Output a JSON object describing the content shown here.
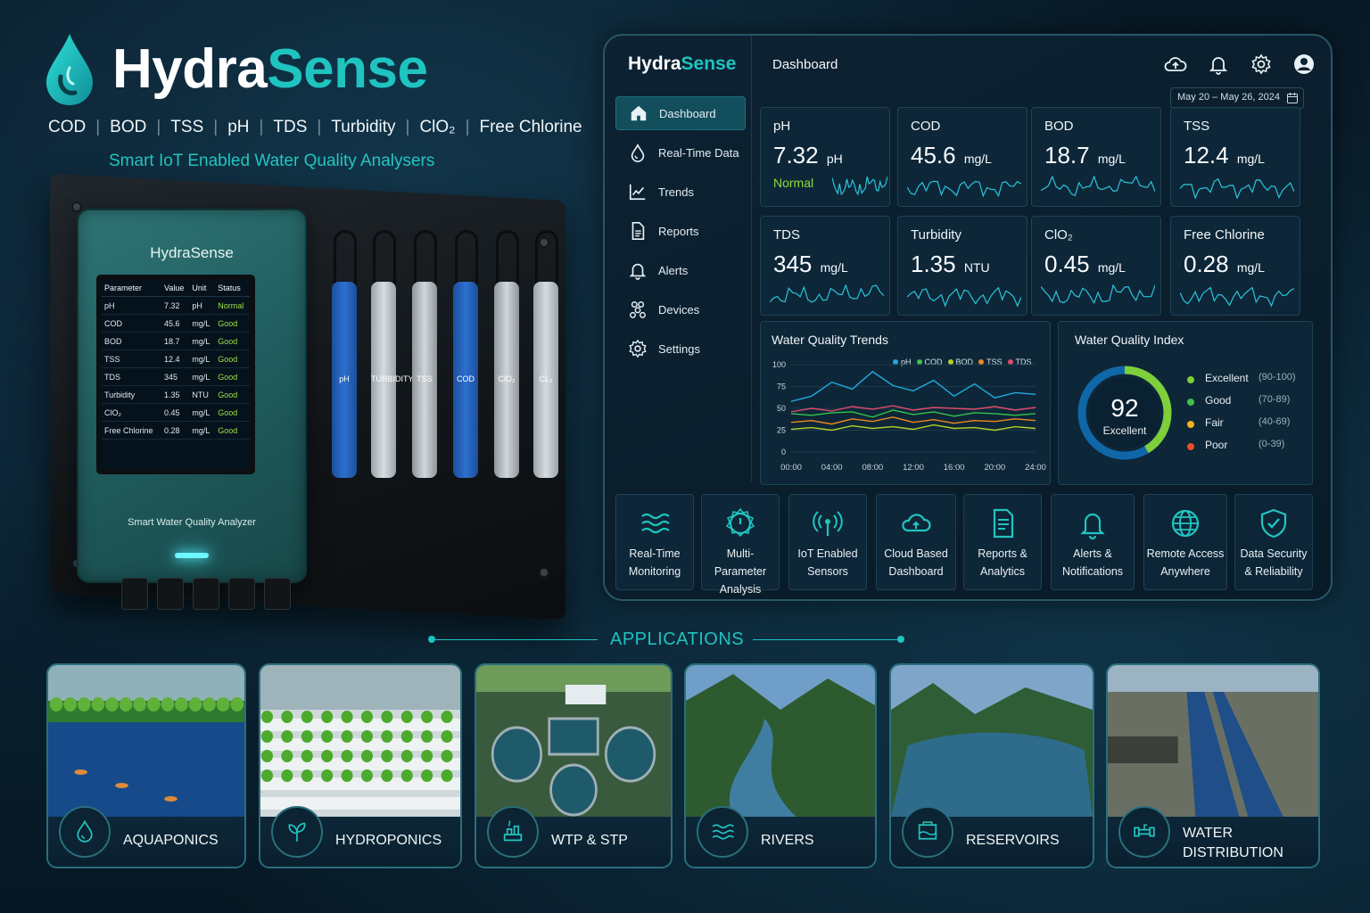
{
  "brand": {
    "name_part1": "Hydra",
    "name_part2": "Sense",
    "parameters": [
      "COD",
      "BOD",
      "TSS",
      "pH",
      "TDS",
      "Turbidity",
      "ClO₂",
      "Free Chlorine"
    ],
    "tagline": "Smart IoT Enabled Water Quality Analysers",
    "accent_color": "#1fc3c0"
  },
  "device": {
    "brand": "HydraSense",
    "caption": "Smart Water Quality Analyzer",
    "table_headers": [
      "Parameter",
      "Value",
      "Unit",
      "Status"
    ],
    "rows": [
      [
        "pH",
        "7.32",
        "pH",
        "Normal"
      ],
      [
        "COD",
        "45.6",
        "mg/L",
        "Good"
      ],
      [
        "BOD",
        "18.7",
        "mg/L",
        "Good"
      ],
      [
        "TSS",
        "12.4",
        "mg/L",
        "Good"
      ],
      [
        "TDS",
        "345",
        "mg/L",
        "Good"
      ],
      [
        "Turbidity",
        "1.35",
        "NTU",
        "Good"
      ],
      [
        "ClO₂",
        "0.45",
        "mg/L",
        "Good"
      ],
      [
        "Free Chlorine",
        "0.28",
        "mg/L",
        "Good"
      ]
    ],
    "probes": [
      "pH",
      "TURBIDITY",
      "TSS",
      "COD",
      "ClO₂",
      "CL₂"
    ]
  },
  "dashboard": {
    "logo_part1": "Hydra",
    "logo_part2": "Sense",
    "title": "Dashboard",
    "date_range": "May 20 – May 26, 2024",
    "top_icons": [
      "cloud-upload-icon",
      "bell-icon",
      "gear-icon",
      "user-avatar-icon"
    ],
    "nav": [
      {
        "label": "Dashboard",
        "icon": "home-icon",
        "active": true
      },
      {
        "label": "Real-Time Data",
        "icon": "water-drop-icon"
      },
      {
        "label": "Trends",
        "icon": "line-chart-icon"
      },
      {
        "label": "Reports",
        "icon": "document-icon"
      },
      {
        "label": "Alerts",
        "icon": "bell-icon"
      },
      {
        "label": "Devices",
        "icon": "devices-icon"
      },
      {
        "label": "Settings",
        "icon": "gear-icon"
      }
    ],
    "metrics": [
      {
        "name": "pH",
        "value": "7.32",
        "unit": "pH",
        "status": "Normal"
      },
      {
        "name": "COD",
        "value": "45.6",
        "unit": "mg/L"
      },
      {
        "name": "BOD",
        "value": "18.7",
        "unit": "mg/L"
      },
      {
        "name": "TSS",
        "value": "12.4",
        "unit": "mg/L"
      },
      {
        "name": "TDS",
        "value": "345",
        "unit": "mg/L"
      },
      {
        "name": "Turbidity",
        "value": "1.35",
        "unit": "NTU"
      },
      {
        "name": "ClO₂",
        "value": "0.45",
        "unit": "mg/L"
      },
      {
        "name": "Free Chlorine",
        "value": "0.28",
        "unit": "mg/L"
      }
    ],
    "trends": {
      "title": "Water Quality Trends",
      "y_ticks": [
        "100",
        "75",
        "50",
        "25",
        "0"
      ],
      "x_ticks": [
        "00:00",
        "04:00",
        "08:00",
        "12:00",
        "16:00",
        "20:00",
        "24:00"
      ],
      "series_colors": {
        "pH": "#23a9e0",
        "COD": "#39c24a",
        "BOD": "#b4cf2a",
        "TSS": "#f08a1d",
        "TDS": "#e04a6a"
      }
    },
    "wqi": {
      "title": "Water Quality Index",
      "score": "92",
      "rating": "Excellent",
      "legend": [
        {
          "label": "Excellent",
          "range": "(90-100)",
          "color": "#7fcf3a"
        },
        {
          "label": "Good",
          "range": "(70-89)",
          "color": "#3fbf4a"
        },
        {
          "label": "Fair",
          "range": "(40-69)",
          "color": "#f1b21f"
        },
        {
          "label": "Poor",
          "range": "(0-39)",
          "color": "#e8502d"
        }
      ]
    },
    "features": [
      {
        "line1": "Real-Time",
        "line2": "Monitoring",
        "icon": "waves-icon"
      },
      {
        "line1": "Multi-Parameter",
        "line2": "Analysis",
        "icon": "gauge-icon"
      },
      {
        "line1": "IoT Enabled",
        "line2": "Sensors",
        "icon": "wireless-sensor-icon"
      },
      {
        "line1": "Cloud Based",
        "line2": "Dashboard",
        "icon": "cloud-icon"
      },
      {
        "line1": "Reports &",
        "line2": "Analytics",
        "icon": "report-icon"
      },
      {
        "line1": "Alerts &",
        "line2": "Notifications",
        "icon": "bell-icon"
      },
      {
        "line1": "Remote Access",
        "line2": "Anywhere",
        "icon": "globe-icon"
      },
      {
        "line1": "Data Security",
        "line2": "& Reliability",
        "icon": "shield-check-icon"
      }
    ]
  },
  "chart_data": {
    "type": "line",
    "title": "Water Quality Trends",
    "x": [
      "00:00",
      "02:00",
      "04:00",
      "06:00",
      "08:00",
      "10:00",
      "12:00",
      "14:00",
      "16:00",
      "18:00",
      "20:00",
      "22:00",
      "24:00"
    ],
    "ylim": [
      0,
      100
    ],
    "legend_position": "top-right",
    "series": [
      {
        "name": "pH",
        "values": [
          58,
          64,
          80,
          72,
          92,
          76,
          70,
          82,
          64,
          78,
          62,
          68,
          66
        ]
      },
      {
        "name": "COD",
        "values": [
          44,
          42,
          45,
          46,
          40,
          48,
          43,
          46,
          41,
          45,
          44,
          42,
          44
        ]
      },
      {
        "name": "BOD",
        "values": [
          26,
          28,
          25,
          30,
          27,
          29,
          26,
          31,
          27,
          28,
          25,
          29,
          27
        ]
      },
      {
        "name": "TSS",
        "values": [
          34,
          36,
          32,
          38,
          35,
          40,
          34,
          37,
          33,
          36,
          35,
          38,
          36
        ]
      },
      {
        "name": "TDS",
        "values": [
          46,
          50,
          47,
          52,
          49,
          53,
          48,
          51,
          50,
          49,
          52,
          48,
          51
        ]
      }
    ]
  },
  "applications": {
    "heading": "APPLICATIONS",
    "items": [
      {
        "label": "AQUAPONICS",
        "icon": "water-drop-icon"
      },
      {
        "label": "HYDROPONICS",
        "icon": "plant-icon"
      },
      {
        "label": "WTP & STP",
        "icon": "treatment-plant-icon"
      },
      {
        "label": "RIVERS",
        "icon": "waves-icon"
      },
      {
        "label": "RESERVOIRS",
        "icon": "reservoir-icon"
      },
      {
        "label": "WATER DISTRIBUTION PIPELINES",
        "icon": "pipeline-icon"
      }
    ]
  }
}
